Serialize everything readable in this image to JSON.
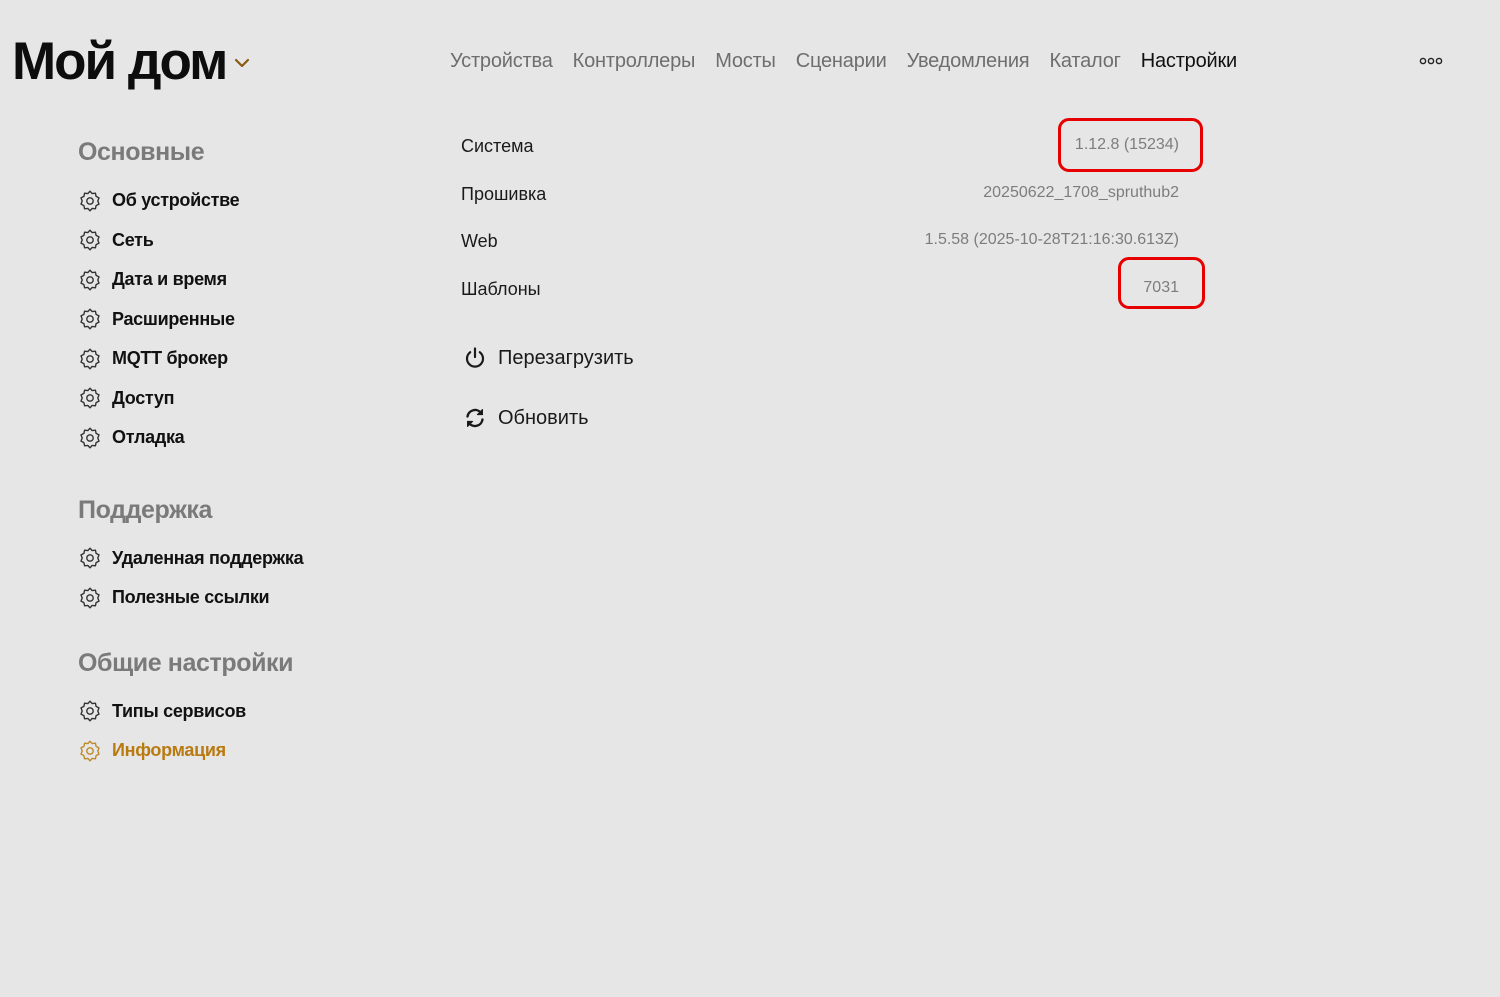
{
  "header": {
    "title": "Мой дом",
    "title_dropdown_icon": "chevron-down-icon",
    "more_icon": "more-dots-icon"
  },
  "nav": {
    "items": [
      {
        "label": "Устройства"
      },
      {
        "label": "Контроллеры"
      },
      {
        "label": "Мосты"
      },
      {
        "label": "Сценарии"
      },
      {
        "label": "Уведомления"
      },
      {
        "label": "Каталог"
      },
      {
        "label": "Настройки",
        "active": true
      }
    ]
  },
  "sidebar": {
    "item_icon": "gear-icon",
    "sections": [
      {
        "title": "Основные",
        "items": [
          {
            "label": "Об устройстве"
          },
          {
            "label": "Сеть"
          },
          {
            "label": "Дата и время"
          },
          {
            "label": "Расширенные"
          },
          {
            "label": "MQTT брокер"
          },
          {
            "label": "Доступ"
          },
          {
            "label": "Отладка"
          }
        ]
      },
      {
        "title": "Поддержка",
        "items": [
          {
            "label": "Удаленная поддержка"
          },
          {
            "label": "Полезные ссылки"
          }
        ]
      },
      {
        "title": "Общие настройки",
        "items": [
          {
            "label": "Типы сервисов"
          },
          {
            "label": "Информация",
            "active": true
          }
        ]
      }
    ]
  },
  "info": {
    "rows": [
      {
        "label": "Система",
        "value": "1.12.8 (15234)",
        "highlighted": true
      },
      {
        "label": "Прошивка",
        "value": "20250622_1708_spruthub2"
      },
      {
        "label": "Web",
        "value": "1.5.58 (2025-10-28T21:16:30.613Z)"
      },
      {
        "label": "Шаблоны",
        "value": "7031",
        "highlighted": true
      }
    ],
    "highlight_color": "#e60000"
  },
  "actions": {
    "restart": {
      "label": "Перезагрузить",
      "icon": "power-icon"
    },
    "update": {
      "label": "Обновить",
      "icon": "refresh-icon"
    }
  },
  "colors": {
    "background": "#e6e6e6",
    "accent": "#b97a10",
    "text": "#111111",
    "muted": "#7a7a7a"
  }
}
